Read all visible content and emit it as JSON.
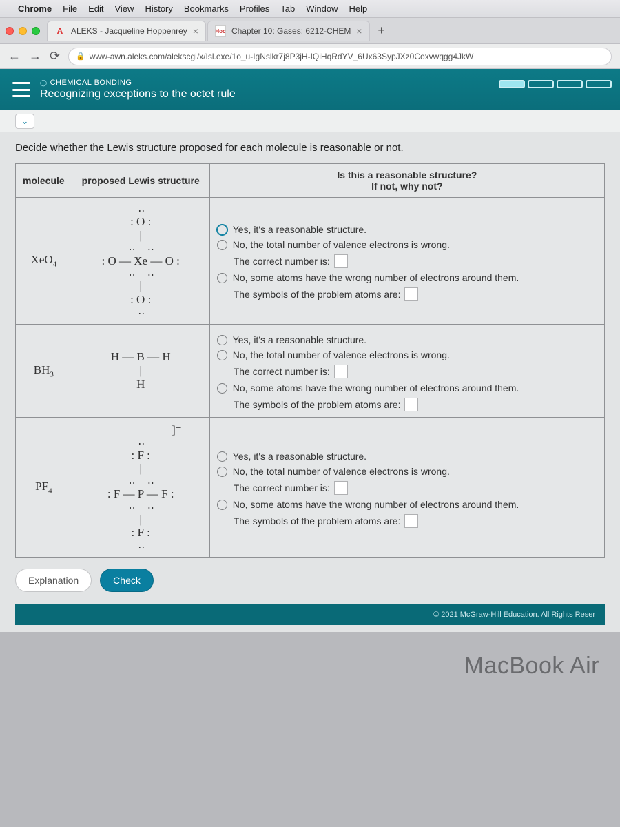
{
  "menubar": {
    "app": "Chrome",
    "items": [
      "File",
      "Edit",
      "View",
      "History",
      "Bookmarks",
      "Profiles",
      "Tab",
      "Window",
      "Help"
    ]
  },
  "tabs": [
    {
      "favicon": "A",
      "faviconColor": "#d33",
      "title": "ALEKS - Jacqueline Hoppenrey"
    },
    {
      "favicon": "Hoc",
      "faviconColor": "#c33",
      "title": "Chapter 10: Gases: 6212-CHEM"
    }
  ],
  "url": "www-awn.aleks.com/alekscgi/x/Isl.exe/1o_u-IgNslkr7j8P3jH-IQiHqRdYV_6Ux63SypJXz0Coxvwqgg4JkW",
  "header": {
    "category": "CHEMICAL BONDING",
    "title": "Recognizing exceptions to the octet rule"
  },
  "prompt": "Decide whether the Lewis structure proposed for each molecule is reasonable or not.",
  "columns": {
    "c1": "molecule",
    "c2": "proposed Lewis structure",
    "c3": "Is this a reasonable structure?\nIf not, why not?"
  },
  "opts": {
    "yes": "Yes, it's a reasonable structure.",
    "no1": "No, the total number of valence electrons is wrong.",
    "no1sub": "The correct number is:",
    "no2": "No, some atoms have the wrong number of electrons around them.",
    "no2sub": "The symbols of the problem atoms are:"
  },
  "rows": [
    {
      "mol": "XeO",
      "sub": "4",
      "lewis_top": ": O :",
      "lewis_mid": ": O — Xe — O :",
      "lewis_bot": ": O :"
    },
    {
      "mol": "BH",
      "sub": "3",
      "lewis_top": "",
      "lewis_mid": "H — B — H",
      "lewis_bot": "H"
    },
    {
      "mol": "PF",
      "sub": "4",
      "lewis_top": ": F :",
      "lewis_mid": ": F — P — F :",
      "lewis_bot": ": F :"
    }
  ],
  "buttons": {
    "explain": "Explanation",
    "check": "Check"
  },
  "copyright": "© 2021 McGraw-Hill Education. All Rights Reser",
  "macbook": "MacBook Air"
}
